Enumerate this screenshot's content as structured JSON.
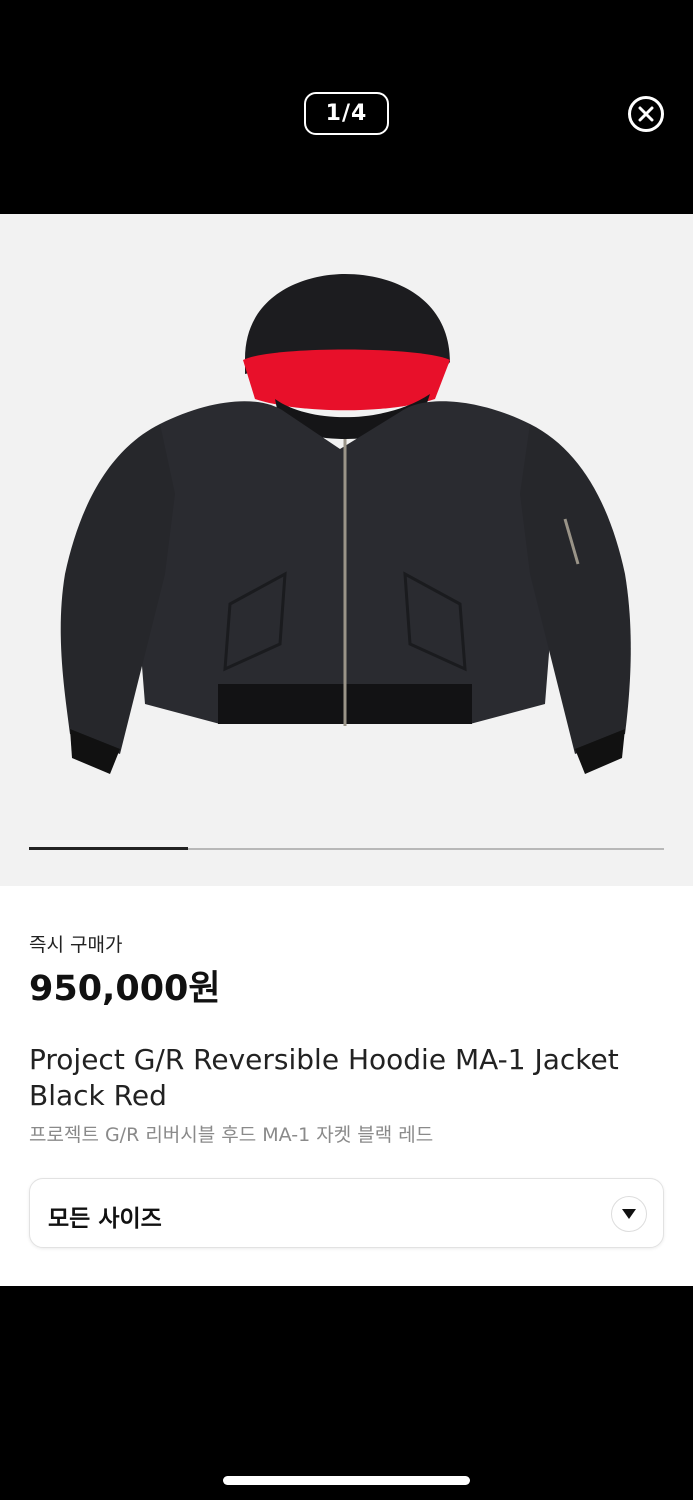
{
  "viewer": {
    "counter": "1/4",
    "current_image": 1,
    "total_images": 4,
    "progress_fraction": 0.25
  },
  "icons": {
    "close": "close-circle-icon",
    "chevron": "chevron-down-icon"
  },
  "product": {
    "price_label": "즉시 구매가",
    "price": "950,000원",
    "title_en": "Project G/R Reversible Hoodie MA-1 Jacket Black Red",
    "title_ko": "프로젝트 G/R 리버시블 후드 MA-1 자켓 블랙 레드"
  },
  "size_select": {
    "label": "모든 사이즈"
  },
  "colors": {
    "background": "#000000",
    "image_bg": "#f2f2f2",
    "jacket": "#2a2b30",
    "hood_lining": "#e8102a"
  }
}
